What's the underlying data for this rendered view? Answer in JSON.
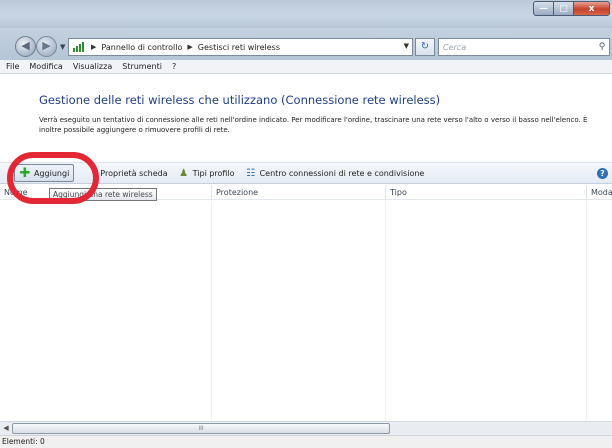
{
  "window": {
    "caption_buttons": {
      "minimize": "—",
      "maximize": "□",
      "close": "x"
    }
  },
  "navigation": {
    "breadcrumb": [
      "Pannello di controllo",
      "Gestisci reti wireless"
    ],
    "search_placeholder": "Cerca",
    "icons": {
      "back": "back-arrow-icon",
      "forward": "forward-arrow-icon",
      "refresh": "refresh-icon",
      "search": "search-icon"
    }
  },
  "menu": {
    "items": [
      "File",
      "Modifica",
      "Visualizza",
      "Strumenti",
      "?"
    ]
  },
  "header": {
    "title": "Gestione delle reti wireless che utilizzano (Connessione rete wireless)",
    "description": "Verrà eseguito un tentativo di connessione alle reti nell'ordine indicato. Per modificare l'ordine, trascinare una rete verso l'alto o verso il basso nell'elenco. È inoltre possibile aggiungere o rimuovere profili di rete."
  },
  "toolbar": {
    "add_label": "Aggiungi",
    "adapter_props_label": "Proprietà scheda",
    "profile_types_label": "Tipi profilo",
    "network_center_label": "Centro connessioni di rete e condivisione",
    "help": "?"
  },
  "tooltip": {
    "text": "Aggiungi una rete wireless"
  },
  "list": {
    "columns": [
      "Nome",
      "Protezione",
      "Tipo",
      "Modalità"
    ],
    "rows": []
  },
  "scrollbar": {
    "thumb_grip": "III"
  },
  "status": {
    "items_label": "Elementi: 0"
  },
  "colors": {
    "title_blue": "#1f3e8a",
    "highlight_red": "#e32734",
    "add_green": "#2ea62e"
  }
}
